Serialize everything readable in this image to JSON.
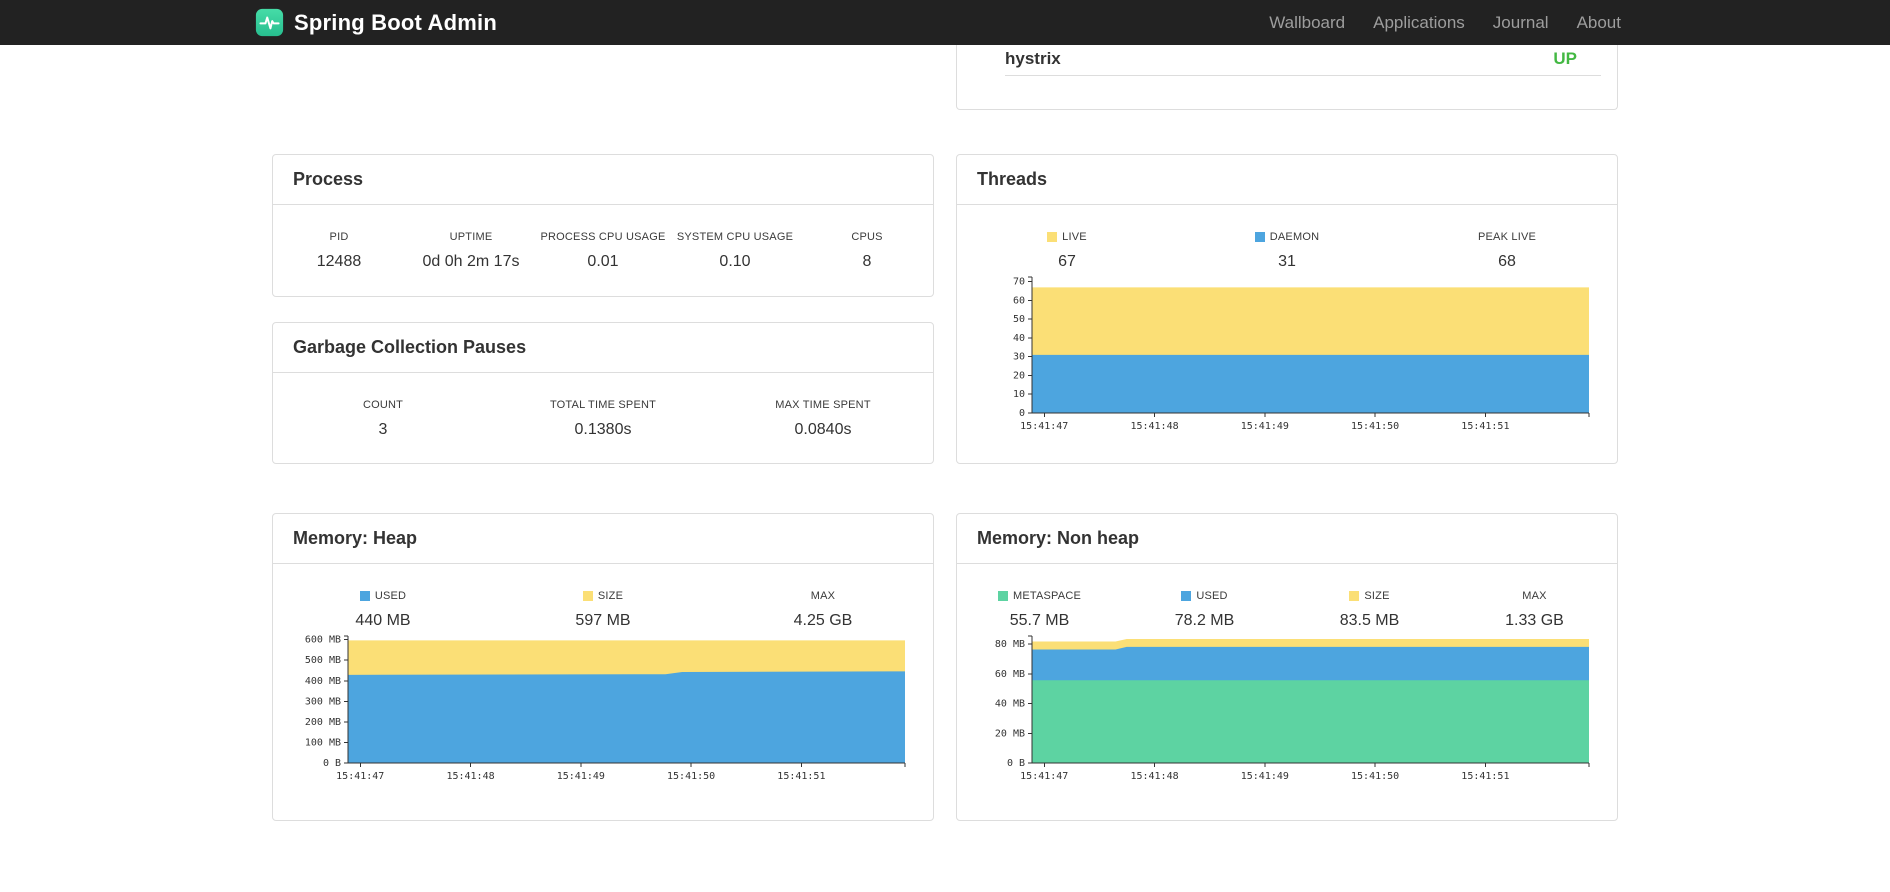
{
  "navbar": {
    "brand": "Spring Boot Admin",
    "links": [
      "Wallboard",
      "Applications",
      "Journal",
      "About"
    ],
    "brand_color": "#35CE9B"
  },
  "application_fragment": {
    "name": "hystrix",
    "status": "UP",
    "status_color": "#43B843"
  },
  "panels": {
    "process": {
      "title": "Process",
      "stats": [
        {
          "label": "PID",
          "value": "12488"
        },
        {
          "label": "UPTIME",
          "value": "0d 0h 2m 17s"
        },
        {
          "label": "PROCESS CPU USAGE",
          "value": "0.01"
        },
        {
          "label": "SYSTEM CPU USAGE",
          "value": "0.10"
        },
        {
          "label": "CPUS",
          "value": "8"
        }
      ]
    },
    "gc": {
      "title": "Garbage Collection Pauses",
      "stats": [
        {
          "label": "COUNT",
          "value": "3"
        },
        {
          "label": "TOTAL TIME SPENT",
          "value": "0.1380s"
        },
        {
          "label": "MAX TIME SPENT",
          "value": "0.0840s"
        }
      ]
    },
    "threads": {
      "title": "Threads",
      "stats": [
        {
          "label": "LIVE",
          "value": "67",
          "swatch": "#FBDF76"
        },
        {
          "label": "DAEMON",
          "value": "31",
          "swatch": "#4DA5DF"
        },
        {
          "label": "PEAK LIVE",
          "value": "68"
        }
      ]
    },
    "heap": {
      "title": "Memory: Heap",
      "stats": [
        {
          "label": "USED",
          "value": "440 MB",
          "swatch": "#4DA5DF"
        },
        {
          "label": "SIZE",
          "value": "597 MB",
          "swatch": "#FBDF76"
        },
        {
          "label": "MAX",
          "value": "4.25 GB"
        }
      ]
    },
    "nonheap": {
      "title": "Memory: Non heap",
      "stats": [
        {
          "label": "METASPACE",
          "value": "55.7 MB",
          "swatch": "#5DD3A2"
        },
        {
          "label": "USED",
          "value": "78.2 MB",
          "swatch": "#4DA5DF"
        },
        {
          "label": "SIZE",
          "value": "83.5 MB",
          "swatch": "#FBDF76"
        },
        {
          "label": "MAX",
          "value": "1.33 GB"
        }
      ]
    }
  },
  "chart_data": {
    "threads": {
      "type": "area",
      "title": "Threads",
      "x_ticks": [
        "15:41:47",
        "15:41:48",
        "15:41:49",
        "15:41:50",
        "15:41:51"
      ],
      "y_ticks": [
        [
          0,
          "0"
        ],
        [
          10,
          "10"
        ],
        [
          20,
          "20"
        ],
        [
          30,
          "30"
        ],
        [
          40,
          "40"
        ],
        [
          50,
          "50"
        ],
        [
          60,
          "60"
        ],
        [
          70,
          "70"
        ]
      ],
      "y_max": 72.5,
      "legend": [
        "LIVE",
        "DAEMON",
        "PEAK LIVE"
      ],
      "series": [
        {
          "name": "live-total",
          "label": "LIVE",
          "color": "#FBDF76",
          "points": [
            [
              0,
              67
            ],
            [
              1,
              67
            ]
          ]
        },
        {
          "name": "daemon",
          "label": "DAEMON",
          "color": "#4DA5DF",
          "points": [
            [
              0,
              31
            ],
            [
              1,
              31
            ]
          ]
        }
      ]
    },
    "heap": {
      "type": "area",
      "title": "Memory: Heap (MB)",
      "x_ticks": [
        "15:41:47",
        "15:41:48",
        "15:41:49",
        "15:41:50",
        "15:41:51"
      ],
      "y_ticks": [
        [
          0,
          "0 B"
        ],
        [
          100,
          "100 MB"
        ],
        [
          200,
          "200 MB"
        ],
        [
          300,
          "300 MB"
        ],
        [
          400,
          "400 MB"
        ],
        [
          500,
          "500 MB"
        ],
        [
          600,
          "600 MB"
        ]
      ],
      "y_max": 618,
      "legend": [
        "USED",
        "SIZE",
        "MAX"
      ],
      "series": [
        {
          "name": "size",
          "label": "SIZE",
          "color": "#FBDF76",
          "points": [
            [
              0,
              597
            ],
            [
              1,
              597
            ]
          ]
        },
        {
          "name": "used",
          "label": "USED",
          "color": "#4DA5DF",
          "points": [
            [
              0,
              429
            ],
            [
              0.57,
              432
            ],
            [
              0.6,
              443
            ],
            [
              1,
              446
            ]
          ]
        }
      ]
    },
    "nonheap": {
      "type": "area",
      "title": "Memory: Non heap (MB)",
      "x_ticks": [
        "15:41:47",
        "15:41:48",
        "15:41:49",
        "15:41:50",
        "15:41:51"
      ],
      "y_ticks": [
        [
          0,
          "0 B"
        ],
        [
          20,
          "20 MB"
        ],
        [
          40,
          "40 MB"
        ],
        [
          60,
          "60 MB"
        ],
        [
          80,
          "80 MB"
        ]
      ],
      "y_max": 85.5,
      "legend": [
        "METASPACE",
        "USED",
        "SIZE",
        "MAX"
      ],
      "series": [
        {
          "name": "size",
          "label": "SIZE",
          "color": "#FBDF76",
          "points": [
            [
              0,
              81.8
            ],
            [
              0.15,
              81.8
            ],
            [
              0.17,
              83.5
            ],
            [
              1,
              83.5
            ]
          ]
        },
        {
          "name": "used",
          "label": "USED",
          "color": "#4DA5DF",
          "points": [
            [
              0,
              76.4
            ],
            [
              0.15,
              76.4
            ],
            [
              0.17,
              78.2
            ],
            [
              1,
              78.2
            ]
          ]
        },
        {
          "name": "metaspace",
          "label": "METASPACE",
          "color": "#5DD3A2",
          "points": [
            [
              0,
              55.7
            ],
            [
              1,
              55.7
            ]
          ]
        }
      ]
    }
  }
}
